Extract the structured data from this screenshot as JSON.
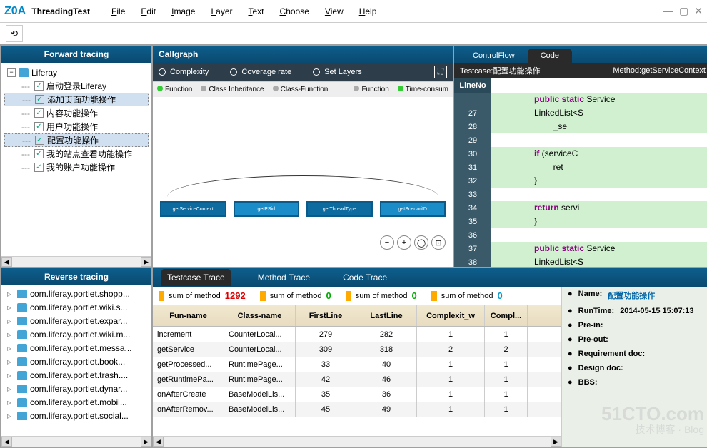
{
  "app": {
    "logo": "Z0A",
    "title": "ThreadingTest"
  },
  "menu": [
    "File",
    "Edit",
    "Image",
    "Layer",
    "Text",
    "Choose",
    "View",
    "Help"
  ],
  "panels": {
    "forward": {
      "title": "Forward tracing",
      "root": "Liferay",
      "children": [
        "启动登录Liferay",
        "添加页面功能操作",
        "内容功能操作",
        "用户功能操作",
        "配置功能操作",
        "我的站点查看功能操作",
        "我的账户功能操作"
      ],
      "selected": [
        1,
        4
      ]
    },
    "reverse": {
      "title": "Reverse tracing",
      "items": [
        "com.liferay.portlet.shopp...",
        "com.liferay.portlet.wiki.s...",
        "com.liferay.portlet.expar...",
        "com.liferay.portlet.wiki.m...",
        "com.liferay.portlet.messa...",
        "com.liferay.portlet.book...",
        "com.liferay.portlet.trash....",
        "com.liferay.portlet.dynar...",
        "com.liferay.portlet.mobil...",
        "com.liferay.portlet.social..."
      ]
    },
    "callgraph": {
      "title": "Callgraph",
      "opts": [
        "Complexity",
        "Coverage rate",
        "Set Layers"
      ],
      "nodes": [
        "getServiceContext",
        "getPSid",
        "getThreadType",
        "getScenariID"
      ],
      "tabs1": [
        "Function",
        "Class Inheritance",
        "Class-Function"
      ],
      "tabs2": [
        "Function",
        "Time-consum"
      ]
    },
    "code": {
      "tabs": [
        "ControlFlow",
        "Code"
      ],
      "active": 1,
      "testcase_label": "Testcase:",
      "testcase": "配置功能操作",
      "method_label": "Method:",
      "method": "getServiceContext",
      "lineno_hdr": "LineNo",
      "lines": [
        {
          "n": "",
          "t": "public static Service",
          "kw": 1,
          "hl": 1
        },
        {
          "n": 27,
          "t": "LinkedList<S",
          "hl": 1
        },
        {
          "n": 28,
          "t": "        _se",
          "hl": 1
        },
        {
          "n": 29,
          "t": ""
        },
        {
          "n": 30,
          "t": "if (serviceC",
          "kw": 1,
          "hl": 1
        },
        {
          "n": 31,
          "t": "        ret",
          "hl": 1
        },
        {
          "n": 32,
          "t": "}",
          "hl": 1
        },
        {
          "n": 33,
          "t": ""
        },
        {
          "n": 34,
          "t": "return servi",
          "kw": 1,
          "hl": 1
        },
        {
          "n": 35,
          "t": "}",
          "hl": 1
        },
        {
          "n": 36,
          "t": ""
        },
        {
          "n": 37,
          "t": "public static Service",
          "kw": 1,
          "hl": 1
        },
        {
          "n": 38,
          "t": "LinkedList<S",
          "hl": 1
        }
      ]
    },
    "trace": {
      "tabs": [
        "Testcase Trace",
        "Method Trace",
        "Code Trace"
      ],
      "active": 0,
      "sums": [
        {
          "label": "sum of method",
          "value": "1292",
          "cls": ""
        },
        {
          "label": "sum of method",
          "value": "0",
          "cls": "g"
        },
        {
          "label": "sum of method",
          "value": "0",
          "cls": "g"
        },
        {
          "label": "sum of method",
          "value": "0",
          "cls": "b"
        }
      ],
      "cols": [
        "Fun-name",
        "Class-name",
        "FirstLine",
        "LastLine",
        "Complexit_w",
        "Compl..."
      ],
      "rows": [
        [
          "increment",
          "CounterLocal...",
          "279",
          "282",
          "1",
          "1"
        ],
        [
          "getService",
          "CounterLocal...",
          "309",
          "318",
          "2",
          "2"
        ],
        [
          "getProcessed...",
          "RuntimePage...",
          "33",
          "40",
          "1",
          "1"
        ],
        [
          "getRuntimePa...",
          "RuntimePage...",
          "42",
          "46",
          "1",
          "1"
        ],
        [
          "onAfterCreate",
          "BaseModelLis...",
          "35",
          "36",
          "1",
          "1"
        ],
        [
          "onAfterRemov...",
          "BaseModelLis...",
          "45",
          "49",
          "1",
          "1"
        ]
      ],
      "info": {
        "name_label": "Name:",
        "name": "配置功能操作",
        "runtime_label": "RunTime:",
        "runtime": "2014-05-15 15:07:13",
        "prein": "Pre-in:",
        "preout": "Pre-out:",
        "req": "Requirement doc:",
        "design": "Design doc:",
        "bbs": "BBS:"
      }
    }
  }
}
